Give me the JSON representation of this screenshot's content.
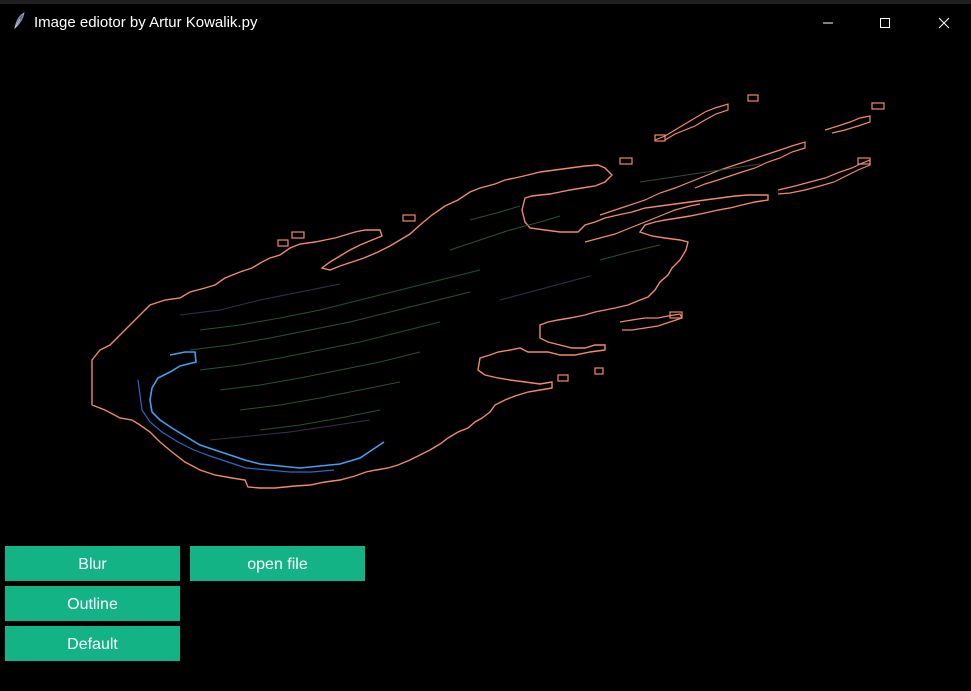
{
  "window": {
    "title": "Image ediotor by Artur Kowalik.py",
    "icons": {
      "app": "feather-icon",
      "minimize": "minimize-icon",
      "maximize": "maximize-icon",
      "close": "close-icon"
    }
  },
  "image": {
    "subject": "comet",
    "filter_applied": "outline"
  },
  "buttons": {
    "blur_label": "Blur",
    "open_file_label": "open file",
    "outline_label": "Outline",
    "default_label": "Default"
  },
  "colors": {
    "background": "#000000",
    "button": "#13b386",
    "button_text": "#ffffff",
    "title_text": "#ffffff",
    "edge_primary": "#f08a6a",
    "edge_secondary": "#3fa0f0",
    "edge_inner": "#2f5a3a"
  }
}
